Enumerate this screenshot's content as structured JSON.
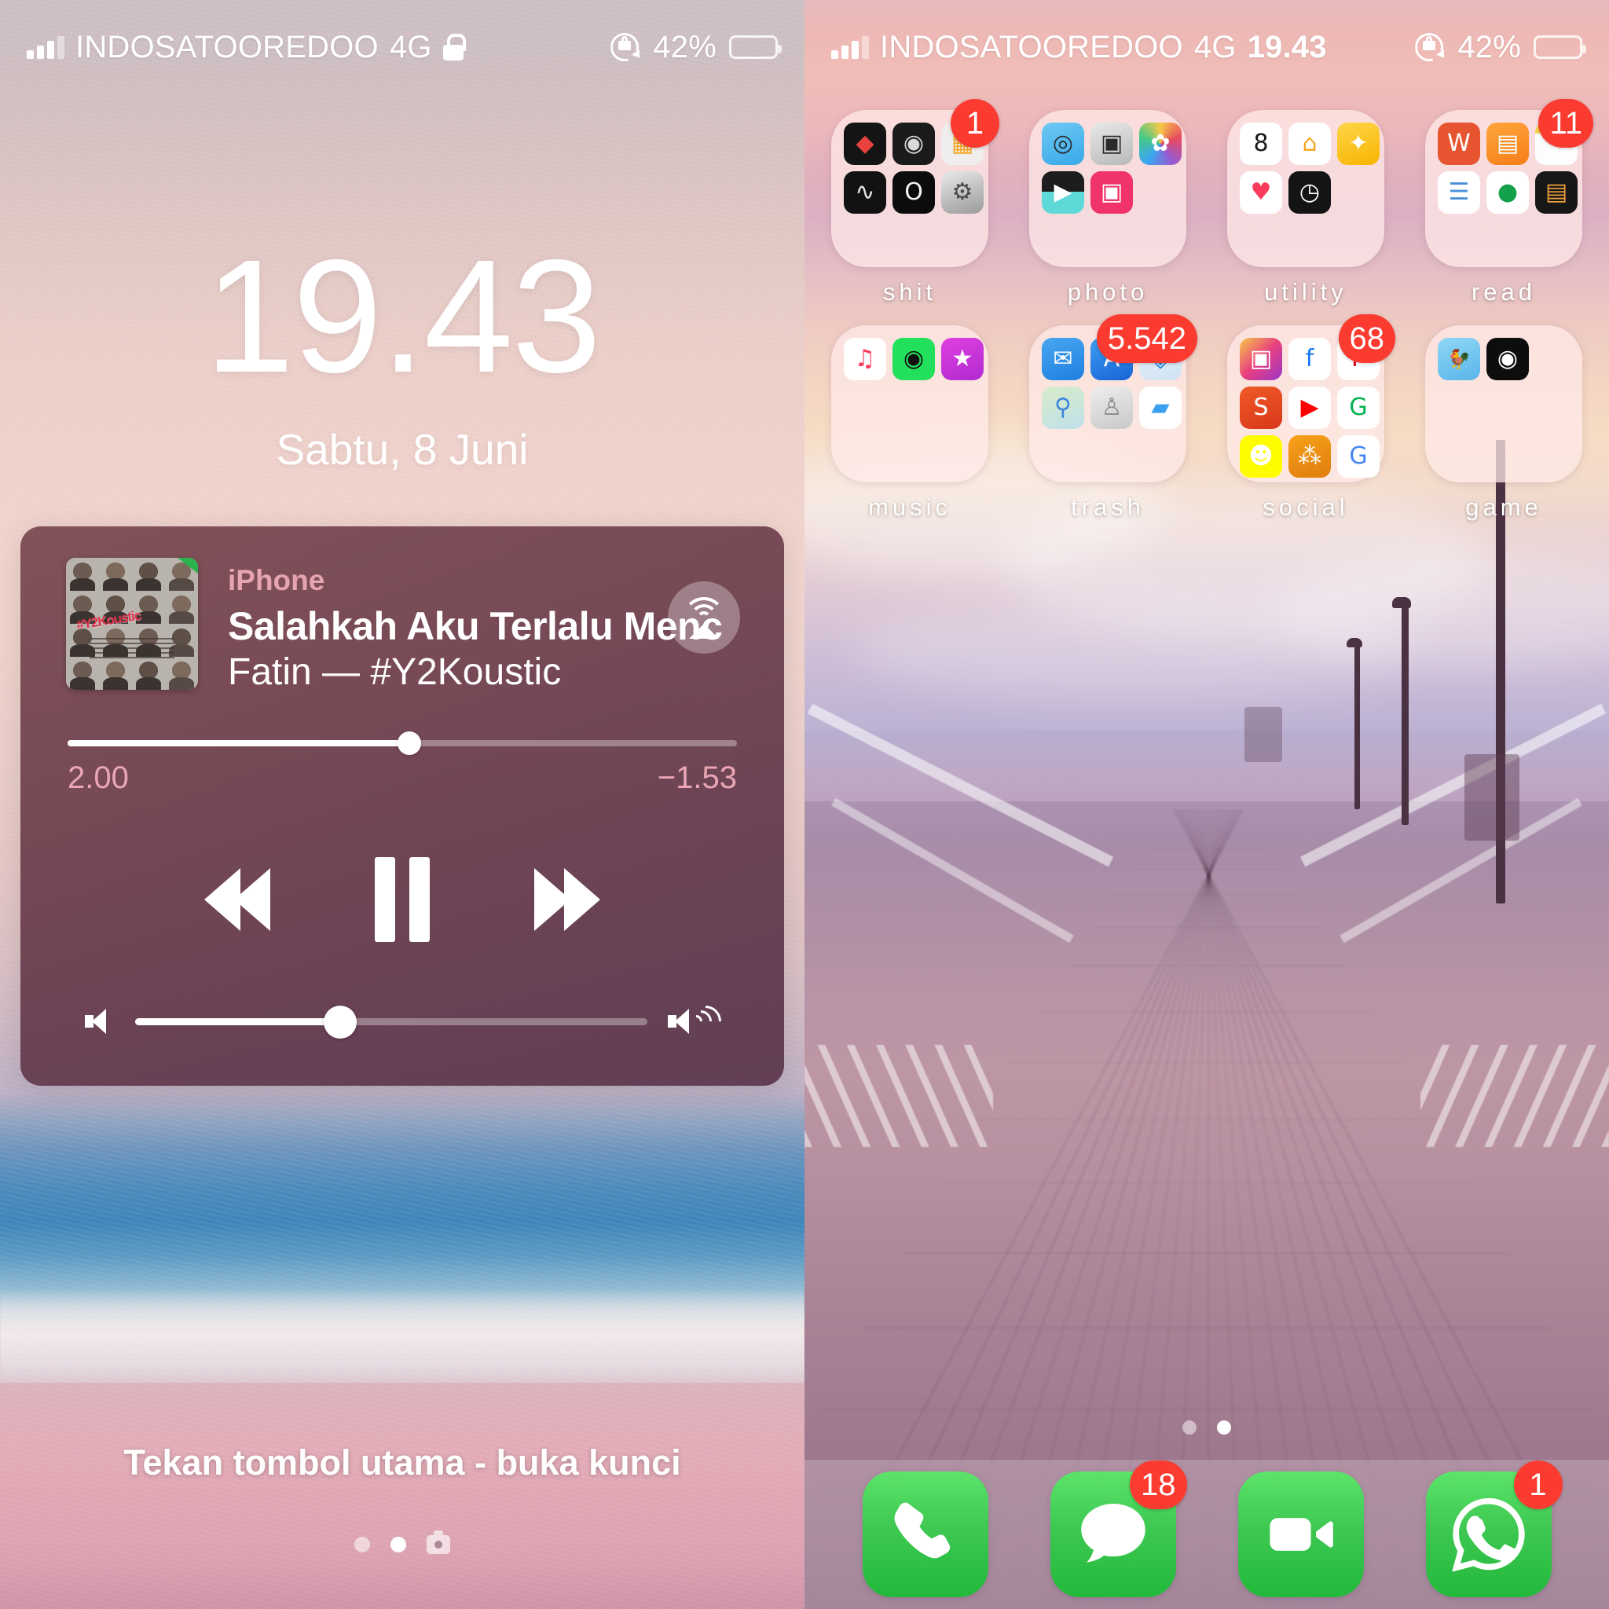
{
  "lock_screen": {
    "status_bar": {
      "carrier": "INDOSATOOREDOO",
      "network": "4G",
      "lock_icon": "lock-icon",
      "rotation_lock_icon": "rotation-lock-icon",
      "battery_percent": "42%",
      "battery_level": 42,
      "battery_color": "#ffcc00"
    },
    "clock": "19.43",
    "date": "Sabtu, 8 Juni",
    "now_playing": {
      "source": "iPhone",
      "title": "Salahkah Aku Terlalu Menc",
      "artist_album": "Fatin — #Y2Koustic",
      "album_art_text": "#Y2Koustic",
      "airplay_icon": "airplay-icon",
      "elapsed": "2.00",
      "remaining": "−1.53",
      "progress_percent": 51,
      "volume_percent": 40,
      "prev_icon": "rewind-icon",
      "play_pause_icon": "pause-icon",
      "next_icon": "fast-forward-icon",
      "volume_low_icon": "speaker-low-icon",
      "volume_high_icon": "speaker-high-icon"
    },
    "unlock_hint": "Tekan tombol utama - buka kunci",
    "page_dots": [
      false,
      true
    ],
    "camera_icon": "camera-icon"
  },
  "home_screen": {
    "status_bar": {
      "carrier": "INDOSATOOREDOO",
      "network": "4G",
      "time": "19.43",
      "rotation_lock_icon": "rotation-lock-icon",
      "battery_percent": "42%",
      "battery_level": 42,
      "battery_color": "#ffcc00"
    },
    "folders": [
      {
        "label": "shit",
        "badge": "1",
        "apps": [
          "garageband",
          "compass",
          "calculator",
          "voice-memos",
          "measure",
          "settings"
        ]
      },
      {
        "label": "photo",
        "badge": null,
        "apps": [
          "camera-app",
          "camera-gray",
          "photos",
          "imovie",
          "instasize"
        ]
      },
      {
        "label": "utility",
        "badge": null,
        "apps": [
          "calendar",
          "home",
          "shortcuts",
          "health",
          "clock"
        ]
      },
      {
        "label": "read",
        "badge": "11",
        "apps": [
          "wattpad",
          "books",
          "notes",
          "reminders",
          "pocket",
          "wallet"
        ]
      },
      {
        "label": "music",
        "badge": null,
        "apps": [
          "apple-music",
          "spotify",
          "smule"
        ]
      },
      {
        "label": "trash",
        "badge": "5.542",
        "apps": [
          "mail",
          "app-store",
          "safari",
          "maps",
          "contacts",
          "files"
        ]
      },
      {
        "label": "social",
        "badge": "68",
        "apps": [
          "instagram",
          "facebook",
          "pinterest",
          "shopee",
          "youtube",
          "grab",
          "snapchat",
          "gojek",
          "google"
        ]
      },
      {
        "label": "game",
        "badge": null,
        "apps": [
          "chicken-game",
          "eyes-game"
        ]
      }
    ],
    "page_dots": [
      false,
      true
    ],
    "dock": [
      {
        "name": "Phone",
        "icon": "phone-icon",
        "badge": null
      },
      {
        "name": "Messages",
        "icon": "messages-icon",
        "badge": "18"
      },
      {
        "name": "FaceTime",
        "icon": "facetime-icon",
        "badge": null
      },
      {
        "name": "WhatsApp",
        "icon": "whatsapp-icon",
        "badge": "1"
      }
    ]
  },
  "colors": {
    "badge_red": "#fc3b30",
    "battery_yellow": "#ffcc00",
    "dock_green": "#3ec852",
    "np_accent_pink": "#e6a5ae"
  }
}
